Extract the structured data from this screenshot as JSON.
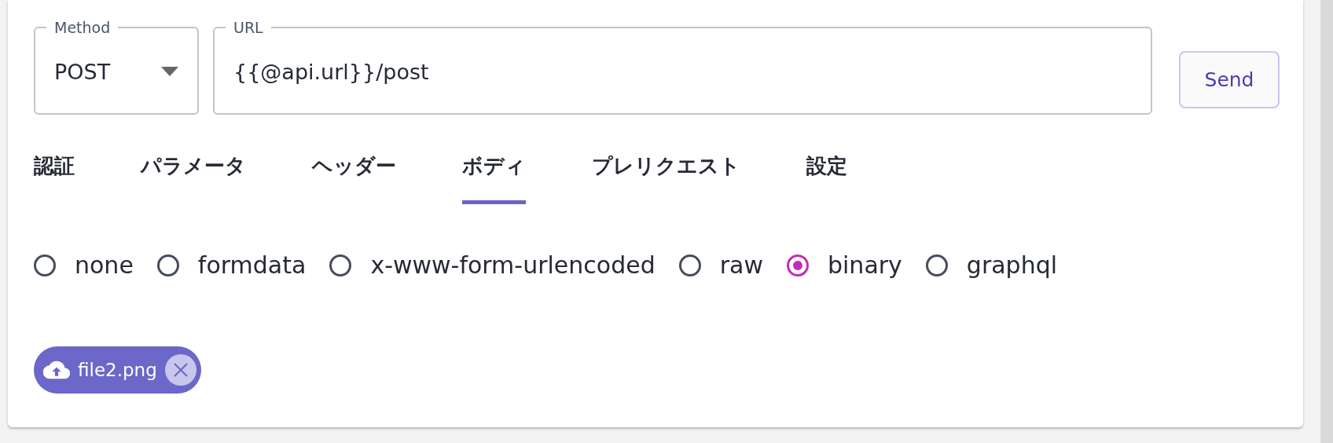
{
  "request": {
    "method": {
      "label": "Method",
      "value": "POST"
    },
    "url": {
      "label": "URL",
      "value": "{{@api.url}}/post"
    },
    "send_button": "Send"
  },
  "tabs": [
    {
      "label": "認証",
      "selected": false
    },
    {
      "label": "パラメータ",
      "selected": false
    },
    {
      "label": "ヘッダー",
      "selected": false
    },
    {
      "label": "ボディ",
      "selected": true
    },
    {
      "label": "プレリクエスト",
      "selected": false
    },
    {
      "label": "設定",
      "selected": false
    }
  ],
  "body_types": [
    {
      "label": "none",
      "selected": false
    },
    {
      "label": "formdata",
      "selected": false
    },
    {
      "label": "x-www-form-urlencoded",
      "selected": false
    },
    {
      "label": "raw",
      "selected": false
    },
    {
      "label": "binary",
      "selected": true
    },
    {
      "label": "graphql",
      "selected": false
    }
  ],
  "file_chip": {
    "name": "file2.png"
  }
}
